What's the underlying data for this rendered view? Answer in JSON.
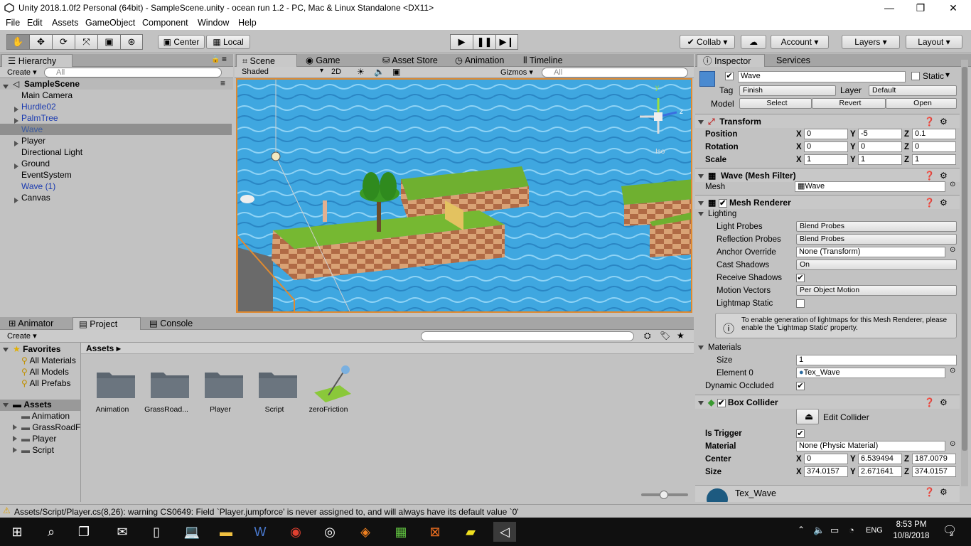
{
  "window": {
    "title": "Unity 2018.1.0f2 Personal (64bit) - SampleScene.unity - ocean run 1.2 - PC, Mac & Linux Standalone <DX11>",
    "minimize": "—",
    "maximize": "❐",
    "close": "✕"
  },
  "menu": [
    "File",
    "Edit",
    "Assets",
    "GameObject",
    "Component",
    "Window",
    "Help"
  ],
  "toolbar": {
    "center": "Center",
    "local": "Local",
    "collab": "Collab ▾",
    "account": "Account",
    "layers": "Layers",
    "layout": "Layout"
  },
  "hierarchy": {
    "tab": "Hierarchy",
    "create": "Create ▾",
    "search": "All",
    "scene": "SampleScene",
    "items": [
      {
        "label": "Main Camera",
        "arrow": false,
        "blue": false
      },
      {
        "label": "Hurdle02",
        "arrow": true,
        "blue": true
      },
      {
        "label": "PalmTree",
        "arrow": true,
        "blue": true
      },
      {
        "label": "Wave",
        "arrow": false,
        "blue": true,
        "selected": true
      },
      {
        "label": "Player",
        "arrow": true,
        "blue": false
      },
      {
        "label": "Directional Light",
        "arrow": false,
        "blue": false
      },
      {
        "label": "Ground",
        "arrow": true,
        "blue": false
      },
      {
        "label": "EventSystem",
        "arrow": false,
        "blue": false
      },
      {
        "label": "Wave (1)",
        "arrow": false,
        "blue": true
      },
      {
        "label": "Canvas",
        "arrow": true,
        "blue": false
      }
    ]
  },
  "scene": {
    "tabs": [
      "Scene",
      "Game",
      "Asset Store",
      "Animation",
      "Timeline"
    ],
    "shaded": "Shaded",
    "twoD": "2D",
    "gizmos": "Gizmos ▾",
    "search": "All",
    "iso": "Iso",
    "axis_y": "y",
    "axis_z": "z"
  },
  "project": {
    "tabs": [
      "Animator",
      "Project",
      "Console"
    ],
    "create": "Create ▾",
    "favorites": "Favorites",
    "fav_items": [
      "All Materials",
      "All Models",
      "All Prefabs"
    ],
    "assets_root": "Assets",
    "asset_tree": [
      "Animation",
      "GrassRoadF",
      "Player",
      "Script"
    ],
    "breadcrumb": "Assets ▸",
    "grid": [
      {
        "label": "Animation",
        "kind": "folder"
      },
      {
        "label": "GrassRoad...",
        "kind": "folder"
      },
      {
        "label": "Player",
        "kind": "folder"
      },
      {
        "label": "Script",
        "kind": "folder"
      },
      {
        "label": "zeroFriction",
        "kind": "physics"
      }
    ]
  },
  "inspector": {
    "tabs": [
      "Inspector",
      "Services"
    ],
    "name": "Wave",
    "static": "Static",
    "tag_label": "Tag",
    "tag": "Finish",
    "layer_label": "Layer",
    "layer": "Default",
    "model_label": "Model",
    "select": "Select",
    "revert": "Revert",
    "open": "Open",
    "transform": {
      "title": "Transform",
      "position_label": "Position",
      "rotation_label": "Rotation",
      "scale_label": "Scale",
      "position": {
        "x": "0",
        "y": "-5",
        "z": "0.1"
      },
      "rotation": {
        "x": "0",
        "y": "0",
        "z": "0"
      },
      "scale": {
        "x": "1",
        "y": "1",
        "z": "1"
      }
    },
    "mesh_filter": {
      "title": "Wave (Mesh Filter)",
      "mesh_label": "Mesh",
      "mesh": "Wave"
    },
    "mesh_renderer": {
      "title": "Mesh Renderer",
      "lighting": "Lighting",
      "light_probes_label": "Light Probes",
      "light_probes": "Blend Probes",
      "refl_label": "Reflection Probes",
      "refl": "Blend Probes",
      "anchor_label": "Anchor Override",
      "anchor": "None (Transform)",
      "cast_label": "Cast Shadows",
      "cast": "On",
      "recv_label": "Receive Shadows",
      "motion_label": "Motion Vectors",
      "motion": "Per Object Motion",
      "lightmap_label": "Lightmap Static",
      "info": "To enable generation of lightmaps for this Mesh Renderer, please enable the 'Lightmap Static' property.",
      "materials": "Materials",
      "size_label": "Size",
      "size": "1",
      "elem_label": "Element 0",
      "elem": "Tex_Wave",
      "dyn_label": "Dynamic Occluded"
    },
    "box_collider": {
      "title": "Box Collider",
      "edit": "Edit Collider",
      "trigger_label": "Is Trigger",
      "material_label": "Material",
      "material": "None (Physic Material)",
      "center_label": "Center",
      "size_label": "Size",
      "center": {
        "x": "0",
        "y": "6.539494",
        "z": "187.0079"
      },
      "size": {
        "x": "374.0157",
        "y": "2.671641",
        "z": "374.0157"
      }
    },
    "material_name": "Tex_Wave"
  },
  "status": "Assets/Script/Player.cs(8,26): warning CS0649: Field `Player.jumpforce' is never assigned to, and will always have its default value `0'",
  "taskbar": {
    "time": "8:53 PM",
    "date": "10/8/2018",
    "lang": "ENG",
    "notif": "2"
  }
}
